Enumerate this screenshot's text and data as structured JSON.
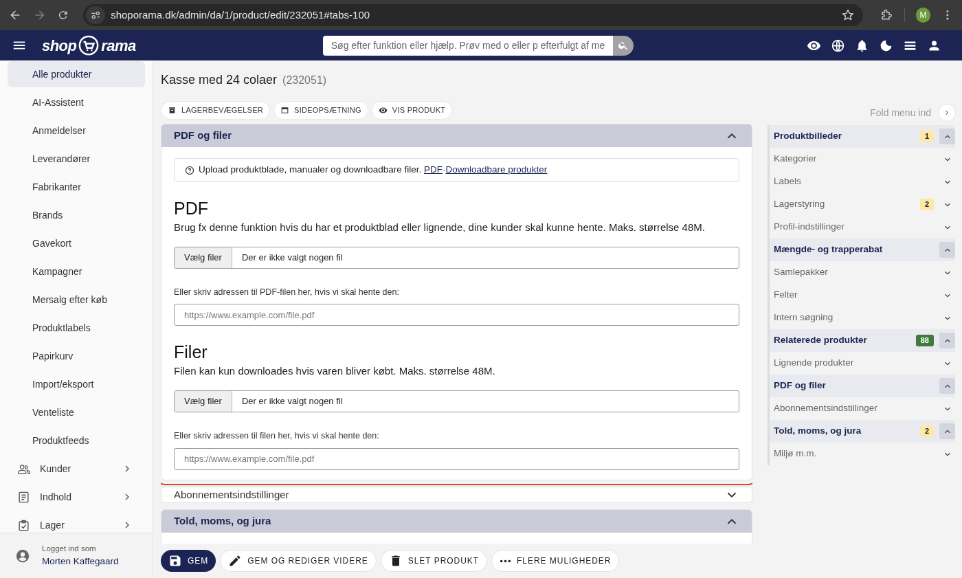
{
  "browser": {
    "url": "shoporama.dk/admin/da/1/product/edit/232051#tabs-100",
    "profile_initial": "M"
  },
  "navbar": {
    "logo_left": "shop",
    "logo_right": "rama",
    "search_placeholder": "Søg efter funktion eller hjælp. Prøv med o eller p efterfulgt af me"
  },
  "sidebar": {
    "items": [
      {
        "label": "Alle produkter",
        "selected": true,
        "kind": "sub"
      },
      {
        "label": "AI-Assistent",
        "selected": false,
        "kind": "sub"
      },
      {
        "label": "Anmeldelser",
        "selected": false,
        "kind": "sub"
      },
      {
        "label": "Leverandører",
        "selected": false,
        "kind": "sub"
      },
      {
        "label": "Fabrikanter",
        "selected": false,
        "kind": "sub"
      },
      {
        "label": "Brands",
        "selected": false,
        "kind": "sub"
      },
      {
        "label": "Gavekort",
        "selected": false,
        "kind": "sub"
      },
      {
        "label": "Kampagner",
        "selected": false,
        "kind": "sub"
      },
      {
        "label": "Mersalg efter køb",
        "selected": false,
        "kind": "sub"
      },
      {
        "label": "Produktlabels",
        "selected": false,
        "kind": "sub"
      },
      {
        "label": "Papirkurv",
        "selected": false,
        "kind": "sub"
      },
      {
        "label": "Import/eksport",
        "selected": false,
        "kind": "sub"
      },
      {
        "label": "Venteliste",
        "selected": false,
        "kind": "sub"
      },
      {
        "label": "Produktfeeds",
        "selected": false,
        "kind": "sub"
      },
      {
        "label": "Kunder",
        "selected": false,
        "kind": "group"
      },
      {
        "label": "Indhold",
        "selected": false,
        "kind": "group"
      },
      {
        "label": "Lager",
        "selected": false,
        "kind": "group"
      }
    ],
    "user": {
      "caption": "Logget ind som",
      "name": "Morten Kaffegaard"
    }
  },
  "page": {
    "title": "Kasse med 24 colaer",
    "product_id": "(232051)",
    "actions": [
      "LAGERBEVÆGELSER",
      "SIDEOPSÆTNING",
      "VIS PRODUKT"
    ]
  },
  "sections": [
    {
      "title": "PDF og filer",
      "expanded": true,
      "kind": "files"
    },
    {
      "title": "Abonnementsindstillinger",
      "expanded": false
    },
    {
      "title": "Told, moms, og jura",
      "expanded": true
    }
  ],
  "files_section": {
    "info": {
      "text": "Upload produktblade, manualer og downloadbare filer.",
      "links": [
        "PDF",
        "Downloadbare produkter"
      ],
      "separator": "·"
    },
    "blocks": [
      {
        "heading": "PDF",
        "description": "Brug fx denne funktion hvis du har et produktblad eller lignende, dine kunder skal kunne hente. Maks. størrelse 48M.",
        "file_button": "Vælg filer",
        "file_status": "Der er ikke valgt nogen fil",
        "url_label": "Eller skriv adressen til PDF-filen her, hvis vi skal hente den:",
        "url_placeholder": "https://www.example.com/file.pdf"
      },
      {
        "heading": "Filer",
        "description": "Filen kan kun downloades hvis varen bliver købt. Maks. størrelse 48M.",
        "file_button": "Vælg filer",
        "file_status": "Der er ikke valgt nogen fil",
        "url_label": "Eller skriv adressen til filen her, hvis vi skal hente den:",
        "url_placeholder": "https://www.example.com/file.pdf"
      }
    ]
  },
  "right_menu": {
    "collapse_label": "Fold menu ind",
    "items": [
      {
        "label": "Produktbilleder",
        "expanded": true,
        "badge": "1",
        "color": "#fde8a8"
      },
      {
        "label": "Kategorier",
        "expanded": false
      },
      {
        "label": "Labels",
        "expanded": false
      },
      {
        "label": "Lagerstyring",
        "expanded": false,
        "badge": "2",
        "color": "#fde8a8"
      },
      {
        "label": "Profil-indstillinger",
        "expanded": false
      },
      {
        "label": "Mængde- og trapperabat",
        "expanded": true
      },
      {
        "label": "Samlepakker",
        "expanded": false
      },
      {
        "label": "Felter",
        "expanded": false
      },
      {
        "label": "Intern søgning",
        "expanded": false
      },
      {
        "label": "Relaterede produkter",
        "expanded": true,
        "badge": "88",
        "color": "#3e7b3a"
      },
      {
        "label": "Lignende produkter",
        "expanded": false
      },
      {
        "label": "PDF og filer",
        "expanded": true
      },
      {
        "label": "Abonnementsindstillinger",
        "expanded": false
      },
      {
        "label": "Told, moms, og jura",
        "expanded": true,
        "badge": "2",
        "color": "#fde8a8"
      },
      {
        "label": "Miljø m.m.",
        "expanded": false
      }
    ]
  },
  "bottom_bar": [
    {
      "label": "GEM",
      "kind": "primary"
    },
    {
      "label": "GEM OG REDIGER VIDERE",
      "kind": "plain"
    },
    {
      "label": "SLET PRODUKT",
      "kind": "plain"
    },
    {
      "label": "FLERE MULIGHEDER",
      "kind": "plain"
    }
  ]
}
